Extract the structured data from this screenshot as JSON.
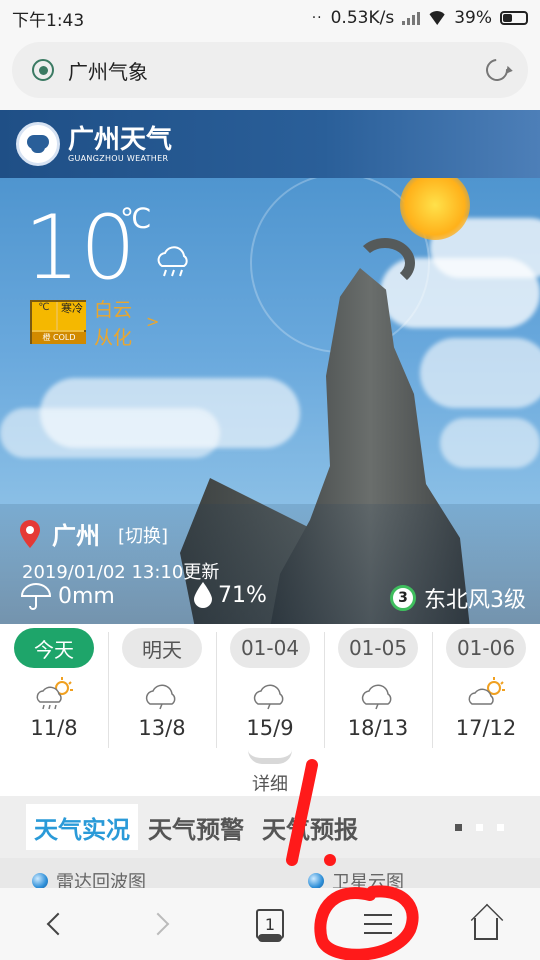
{
  "status_bar": {
    "time": "下午1:43",
    "net_speed": "0.53K/s",
    "battery": "39%"
  },
  "browser": {
    "page_title": "广州气象",
    "site_icon": "site-icon",
    "refresh_icon": "refresh-icon"
  },
  "banner": {
    "brand_cn": "广州天气",
    "brand_en": "GUANGZHOU WEATHER"
  },
  "current": {
    "temperature": "10",
    "unit": "℃",
    "condition_icon": "cloud-rain-icon",
    "warning": {
      "top_left": "℃",
      "top_right": "寒冷",
      "bottom_left": "橙",
      "bottom_right": "COLD",
      "color": "#f5b800"
    },
    "districts": [
      "白云",
      "从化"
    ],
    "districts_more": ">",
    "city": "广州",
    "switch_label": "[切换]",
    "updated": "2019/01/02 13:10更新",
    "rainfall": "0mm",
    "humidity": "71%",
    "wind_level_badge": "3",
    "wind": "东北风3级"
  },
  "forecast": [
    {
      "label": "今天",
      "icon": "cloud-sun-rain-icon",
      "range": "11/8",
      "active": true
    },
    {
      "label": "明天",
      "icon": "cloud-icon",
      "range": "13/8",
      "active": false
    },
    {
      "label": "01-04",
      "icon": "cloud-icon",
      "range": "15/9",
      "active": false
    },
    {
      "label": "01-05",
      "icon": "cloud-icon",
      "range": "18/13",
      "active": false
    },
    {
      "label": "01-06",
      "icon": "cloud-sun-icon",
      "range": "17/12",
      "active": false
    }
  ],
  "detail_label": "详细",
  "section_tabs": [
    "天气实况",
    "天气预警",
    "天气预报"
  ],
  "section_sublinks": [
    "雷达回波图",
    "卫星云图"
  ],
  "nav": {
    "tab_count": "1"
  },
  "annotation": {
    "label": "1.",
    "color": "#ff1a1a"
  },
  "colors": {
    "accent_green": "#1ea56a",
    "tab_active_blue": "#2a9ad8",
    "banner_blue": "#1f4f86",
    "district_orange": "#e9a62e"
  }
}
